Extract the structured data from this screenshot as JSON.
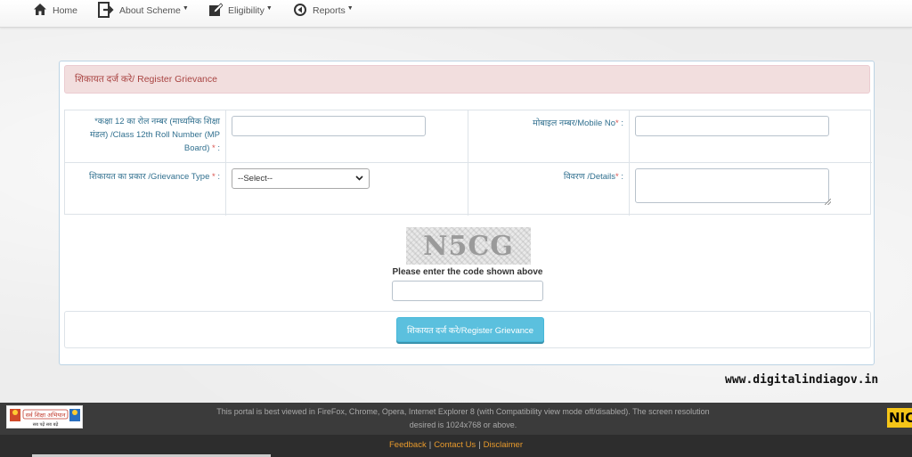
{
  "nav": {
    "home": "Home",
    "about": "About Scheme",
    "eligibility": "Eligibility",
    "reports": "Reports"
  },
  "panel": {
    "heading": "शिकायत दर्ज करे/ Register Grievance"
  },
  "form": {
    "roll_label_1": "*कक्षा 12 का रोल नम्बर (माध्यमिक शिक्षा",
    "roll_label_2": "मंडल) /Class 12th Roll Number (MP",
    "roll_label_3": "Board)",
    "mobile_label": "मोबाइल नम्बर/Mobile No",
    "type_label": "शिकायत का प्रकार /Grievance Type",
    "type_selected": "--Select--",
    "details_label": "विवरण /Details",
    "required_mark": "*",
    "colon": ":"
  },
  "captcha": {
    "code": "N5CG",
    "label": "Please enter the code shown above"
  },
  "submit_label": "शिकायत दर्ज करे/Register Grievance",
  "watermark": "www.digitalindiagov.in",
  "footer": {
    "line1": "This portal is best viewed in FireFox, Chrome, Opera, Internet Explorer 8 (with Compatibility view mode off/disabled). The screen resolution",
    "line2": "desired is 1024x768 or above.",
    "feedback": "Feedback",
    "contact": "Contact Us",
    "disclaimer": "Disclaimer",
    "separator": "|",
    "ssa_logo_text": "सर्व शिक्षा अभियान",
    "ssa_tagline": "सब पढ़ें सब बढ़ें",
    "nic_logo_text": "NIC"
  },
  "colors": {
    "heading_bg": "#f2dede",
    "heading_text": "#a94442",
    "label_text": "#31708f",
    "button_bg": "#5bc0de",
    "footer_link": "#e89a2c",
    "footer_bg": "#3b3b3b"
  },
  "icons": [
    "home-icon",
    "sign-in-icon",
    "edit-icon",
    "circle-arrow-left-icon",
    "caret-down-icon",
    "chevron-down-icon"
  ]
}
